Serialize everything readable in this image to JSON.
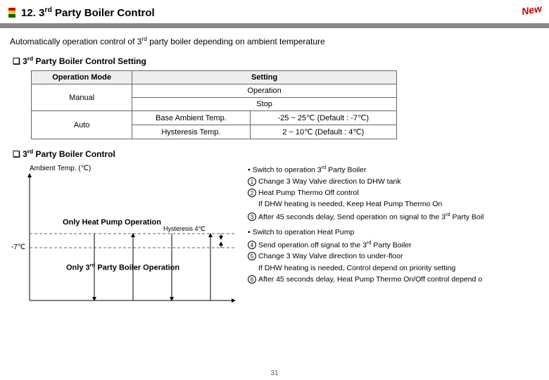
{
  "header": {
    "title_prefix": "12. 3",
    "title_sup": "rd",
    "title_suffix": " Party Boiler Control",
    "new_stamp": "New"
  },
  "intro_a": "Automatically operation control of 3",
  "intro_sup": "rd",
  "intro_b": " party boiler depending on ambient temperature",
  "sect1_a": "❏ 3",
  "sect1_sup": "rd",
  "sect1_b": " Party Boiler Control Setting",
  "table": {
    "h1": "Operation Mode",
    "h2": "Setting",
    "r1c1": "Manual",
    "r1c2a": "Operation",
    "r1c2b": "Stop",
    "r2c1": "Auto",
    "r2c2a": "Base Ambient Temp.",
    "r2c3a": "-25 ~ 25℃ (Default : -7℃)",
    "r2c2b": "Hysteresis Temp.",
    "r2c3b": "2 ~ 10℃ (Default : 4℃)"
  },
  "sect2_a": "❏ 3",
  "sect2_sup": "rd",
  "sect2_b": " Party Boiler Control",
  "diagram": {
    "ylabel": "Ambient Temp. (℃)",
    "zone1": "Only Heat Pump Operation",
    "hyst": "Hysteresis 4℃",
    "zone2_a": "Only 3",
    "zone2_sup": "rd",
    "zone2_b": " Party Boiler Operation",
    "ytick": "-7℃"
  },
  "notes": {
    "l1a": "• Switch to operation 3",
    "l1sup": "rd",
    "l1b": " Party Boiler",
    "l2": "Change 3 Way Valve direction to DHW tank",
    "l3": "Heat Pump Thermo Off control",
    "l4": "If DHW heating is needed, Keep Heat Pump Thermo On",
    "l5a": "After 45 seconds delay, Send operation on signal to the 3",
    "l5sup": "rd",
    "l5b": " Party Boil",
    "l6": "• Switch to operation Heat Pump",
    "l7a": "Send operation off signal to the 3",
    "l7sup": "rd",
    "l7b": " Party Boiler",
    "l8": "Change 3 Way Valve direction to under-floor",
    "l9": "If DHW heating is needed, Control depend on priority setting",
    "l10": "After 45 seconds delay, Heat Pump Thermo On/Off control depend o",
    "c1": "1",
    "c2": "2",
    "c3": "3",
    "c4": "4",
    "c5": "5",
    "c6": "6"
  },
  "pagenum": "31"
}
